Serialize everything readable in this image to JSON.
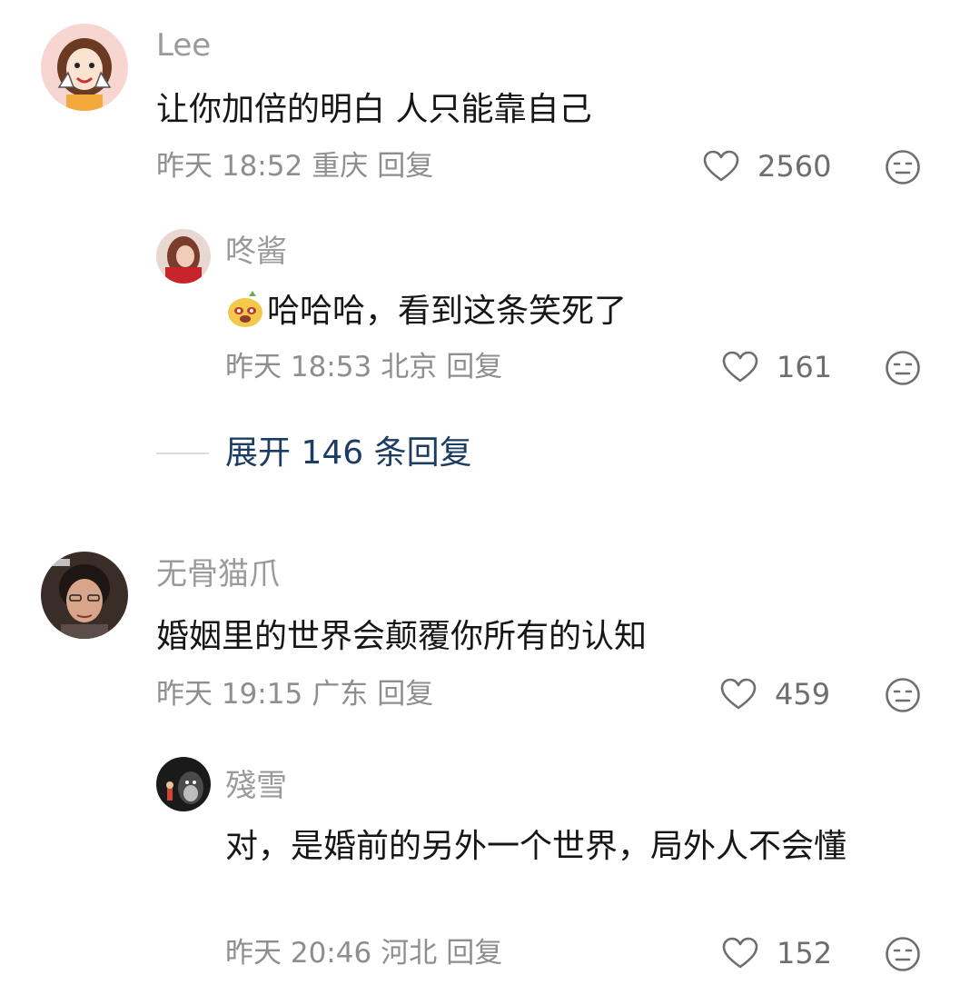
{
  "comments": [
    {
      "name": "Lee",
      "text": "让你加倍的明白 人只能靠自己",
      "time": "昨天 18:52",
      "location": "重庆",
      "reply": "回复",
      "likes": "2560",
      "replies": [
        {
          "name": "咚酱",
          "text": "哈哈哈，看到这条笑死了",
          "time": "昨天 18:53",
          "location": "北京",
          "reply": "回复",
          "likes": "161"
        }
      ],
      "expand": "展开 146 条回复"
    },
    {
      "name": "无骨猫爪",
      "text": "婚姻里的世界会颠覆你所有的认知",
      "time": "昨天 19:15",
      "location": "广东",
      "reply": "回复",
      "likes": "459",
      "replies": [
        {
          "name": "殘雪",
          "text": "对，是婚前的另外一个世界，局外人不会懂",
          "time": "昨天 20:46",
          "location": "河北",
          "reply": "回复",
          "likes": "152"
        }
      ]
    }
  ],
  "icons": {
    "like": "heart-outline-icon",
    "dislike": "neutral-face-icon",
    "inline_emoji": "dog-laugh-emoji-icon"
  },
  "colors": {
    "name": "#9a9a9a",
    "text": "#161616",
    "meta": "#8e8e8e",
    "expand": "#1c3d63"
  }
}
